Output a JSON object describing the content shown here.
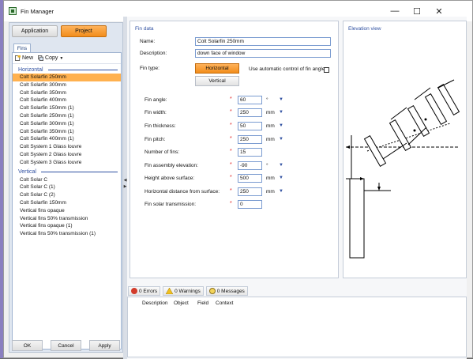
{
  "window": {
    "title": "Fin Manager",
    "min_glyph": "—",
    "max_glyph": "☐",
    "close_glyph": "✕"
  },
  "top_tabs": [
    {
      "label": "Application"
    },
    {
      "label": "Project"
    }
  ],
  "subtab": "Fins",
  "toolbar": {
    "new_label": "New",
    "copy_label": "Copy"
  },
  "groups": [
    {
      "name": "Horizontal",
      "items": [
        "Colt Solarfin 250mm",
        "Colt Solarfin 300mm",
        "Colt Solarfin 350mm",
        "Colt Solarfin 400mm",
        "Colt Solarfin 150mm (1)",
        "Colt Solarfin 250mm (1)",
        "Colt Solarfin 300mm (1)",
        "Colt Solarfin 350mm (1)",
        "Colt Solarfin 400mm (1)",
        "Colt System 1 Glass louvre",
        "Colt System 2 Glass louvre",
        "Colt System 3 Glass louvre"
      ]
    },
    {
      "name": "Vertical",
      "items": [
        "Colt Solar C",
        "Colt Solar C (1)",
        "Colt Solar C (2)",
        "Colt Solarfin 150mm",
        "Vertical fins opaque",
        "Vertical fins 50% transmission",
        "Vertical fins opaque (1)",
        "Vertical fins 50% transmission (1)"
      ]
    }
  ],
  "footer": {
    "ok": "OK",
    "cancel": "Cancel",
    "apply": "Apply"
  },
  "fin_data": {
    "section_title": "Fin data",
    "name_label": "Name:",
    "name_value": "Colt Solarfin 250mm",
    "desc_label": "Description:",
    "desc_value": "down face of window",
    "fin_type_label": "Fin type:",
    "horizontal_btn": "Horizontal",
    "vertical_btn": "Vertical",
    "auto_control_label": "Use automatic control of fin angles",
    "fields": [
      {
        "label": "Fin angle:",
        "value": "60",
        "unit": "°",
        "required": true
      },
      {
        "label": "Fin width:",
        "value": "250",
        "unit": "mm",
        "required": true
      },
      {
        "label": "Fin thickness:",
        "value": "50",
        "unit": "mm",
        "required": true
      },
      {
        "label": "Fin pitch:",
        "value": "250",
        "unit": "mm",
        "required": true
      },
      {
        "label": "Number of fins:",
        "value": "15",
        "unit": "",
        "required": true
      },
      {
        "label": "Fin assembly elevation:",
        "value": "-90",
        "unit": "°",
        "required": true
      },
      {
        "label": "Height above surface:",
        "value": "500",
        "unit": "mm",
        "required": true
      },
      {
        "label": "Horizontal distance from surface:",
        "value": "250",
        "unit": "mm",
        "required": true
      },
      {
        "label": "Fin solar transmission:",
        "value": "0",
        "unit": "",
        "required": true
      }
    ],
    "req_mark": "*",
    "dropdown_glyph": "▼"
  },
  "elevation": {
    "title": "Elevation view"
  },
  "messages": {
    "errors": "0 Errors",
    "warnings": "0 Warnings",
    "messages": "0 Messages"
  },
  "columns": [
    "Description",
    "Object",
    "Field",
    "Context"
  ],
  "colors": {
    "accent": "#f28d1c",
    "selection": "#ffb14f",
    "group_blue": "#2e4fa0"
  }
}
